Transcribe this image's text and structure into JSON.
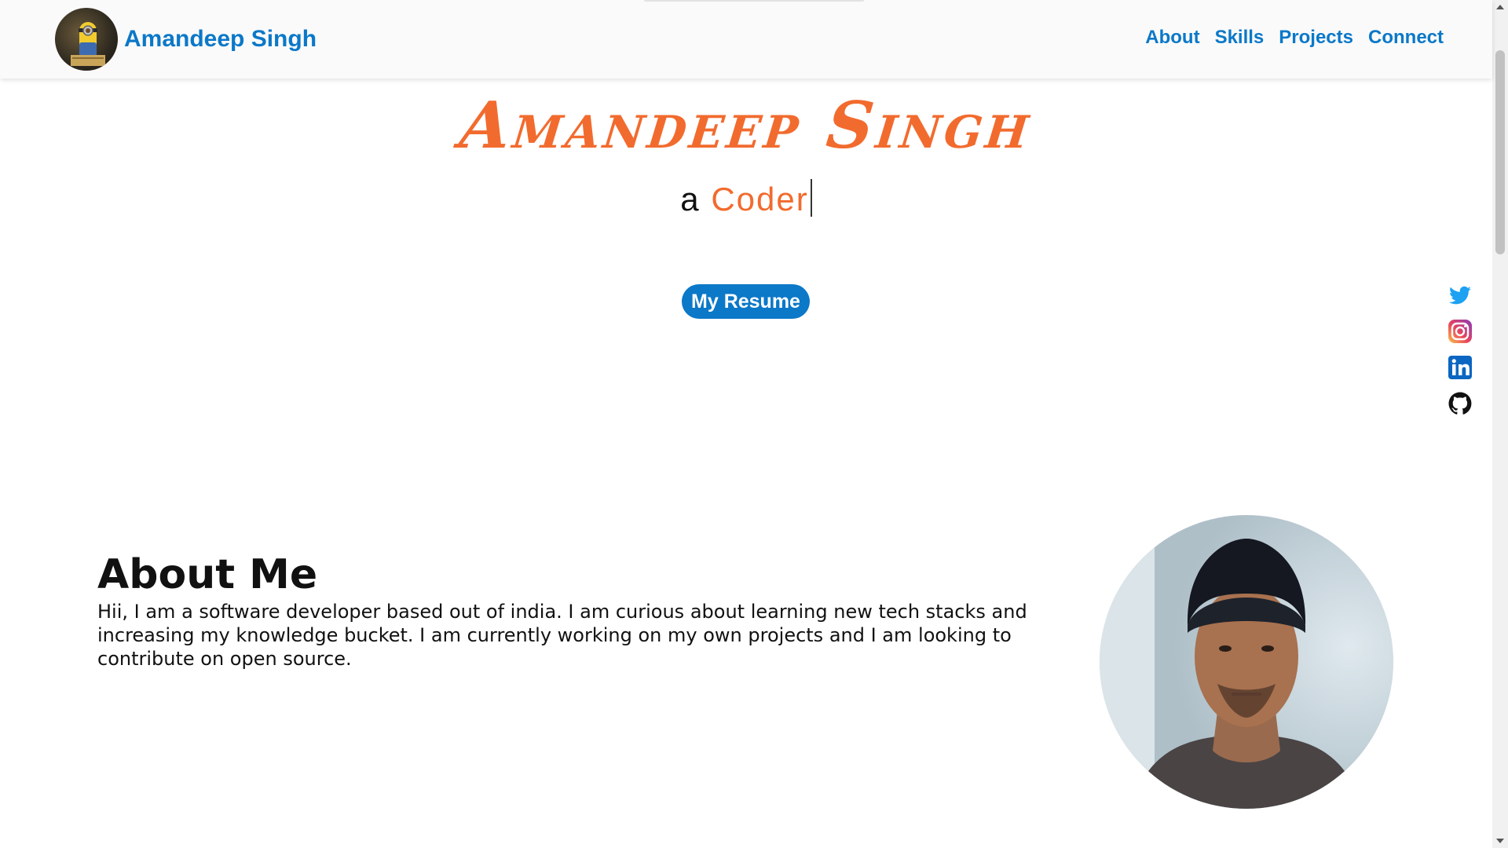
{
  "nav": {
    "brand_name": "Amandeep Singh",
    "links": [
      "About",
      "Skills",
      "Projects",
      "Connect"
    ]
  },
  "hero": {
    "title": "Amandeep Singh",
    "typed_prefix": "a",
    "typed_word": "Coder",
    "resume_label": "My Resume"
  },
  "social": {
    "icons": [
      "twitter-icon",
      "instagram-icon",
      "linkedin-icon",
      "github-icon"
    ]
  },
  "about": {
    "title": "About Me",
    "text": "Hii, I am a software developer based out of india. I am curious about learning new tech stacks and increasing my knowledge bucket. I am currently working on my own projects and I am looking to contribute on open source."
  },
  "colors": {
    "brand_blue": "#0b78c8",
    "accent_orange": "#f26b2e"
  }
}
